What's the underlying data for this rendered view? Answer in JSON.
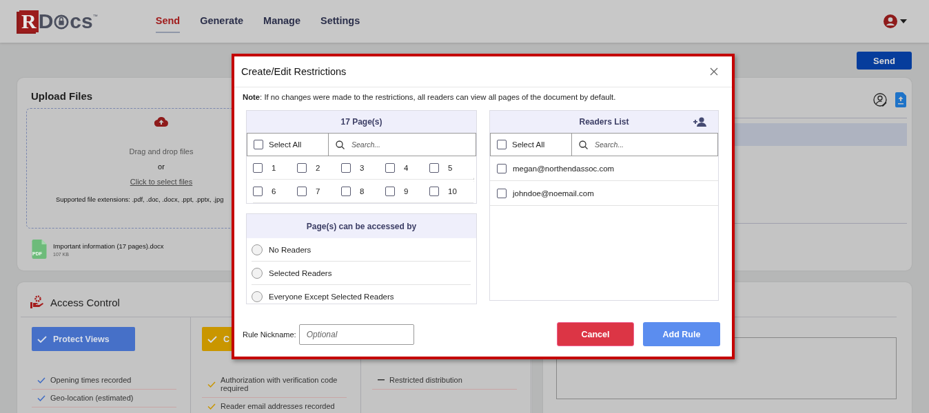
{
  "header": {
    "logo": {
      "letter": "R",
      "before_lock": "D",
      "after_lock": "cs",
      "trademark": "™"
    },
    "nav": [
      {
        "label": "Send",
        "selected": true
      },
      {
        "label": "Generate",
        "selected": false
      },
      {
        "label": "Manage",
        "selected": false
      },
      {
        "label": "Settings",
        "selected": false
      }
    ]
  },
  "send_button": "Send",
  "upload": {
    "title": "Upload Files",
    "drop_text": "Drag and drop files",
    "or": "or",
    "select_link": "Click to select files",
    "extensions": "Supported file extensions: .pdf, .doc, .docx, .ppt, .pptx, .jpg",
    "file": {
      "name": "Important information (17 pages).docx",
      "size": "107 KB",
      "badge": "PDF"
    }
  },
  "access_control": {
    "title": "Access Control",
    "columns": [
      {
        "button": "Protect Views",
        "color": "#4670c8",
        "items": [
          {
            "kind": "check",
            "text": "Opening times recorded"
          },
          {
            "kind": "check",
            "text": "Geo-location (estimated)"
          }
        ]
      },
      {
        "button": "C",
        "color": "#c99600",
        "items": [
          {
            "kind": "check",
            "text": "Authorization with verification code required"
          },
          {
            "kind": "check",
            "text": "Reader email addresses recorded"
          }
        ]
      },
      {
        "items": [
          {
            "kind": "dash",
            "text": "Restricted distribution"
          }
        ]
      }
    ]
  },
  "dialog": {
    "title": "Create/Edit Restrictions",
    "note_label": "Note",
    "note": ": If no changes were made to the restrictions, all readers can view all pages of the document by default.",
    "pages": {
      "title": "17 Page(s)",
      "select_all": {
        "label": "Select All",
        "checked": false
      },
      "search_placeholder": "Search...",
      "items": [
        {
          "label": "1",
          "checked": false
        },
        {
          "label": "2",
          "checked": false
        },
        {
          "label": "3",
          "checked": false
        },
        {
          "label": "4",
          "checked": false
        },
        {
          "label": "5",
          "checked": false
        },
        {
          "label": "6",
          "checked": false
        },
        {
          "label": "7",
          "checked": false
        },
        {
          "label": "8",
          "checked": false
        },
        {
          "label": "9",
          "checked": false
        },
        {
          "label": "10",
          "checked": false
        }
      ]
    },
    "access": {
      "title": "Page(s) can be accessed by",
      "options": [
        {
          "label": "No Readers",
          "selected": false
        },
        {
          "label": "Selected Readers",
          "selected": false
        },
        {
          "label": "Everyone Except Selected Readers",
          "selected": false
        }
      ]
    },
    "readers": {
      "title": "Readers List",
      "select_all": {
        "label": "Select All",
        "checked": false
      },
      "search_placeholder": "Search...",
      "items": [
        {
          "email": "megan@northendassoc.com",
          "checked": false
        },
        {
          "email": "johndoe@noemail.com",
          "checked": false
        }
      ]
    },
    "nickname_label": "Rule Nickname:",
    "nickname_placeholder": "Optional",
    "buttons": [
      {
        "kind": "cancel",
        "label": "Cancel"
      },
      {
        "kind": "primary",
        "label": "Add Rule"
      }
    ]
  }
}
